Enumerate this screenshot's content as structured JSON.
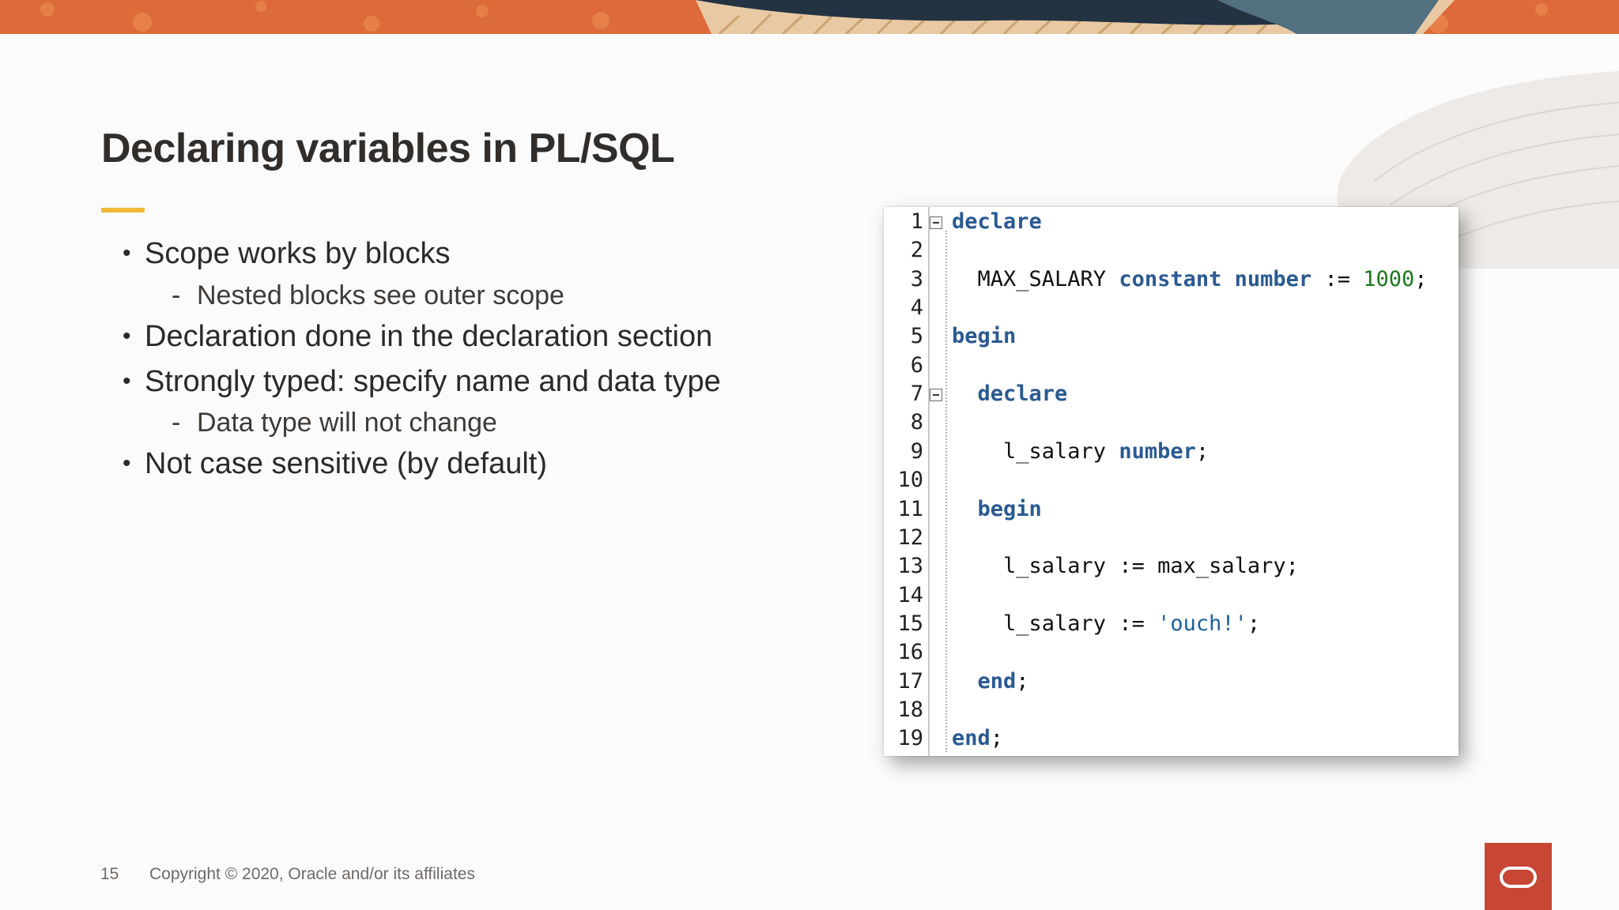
{
  "slide": {
    "title": "Declaring variables in PL/SQL",
    "bullets": [
      {
        "text": "Scope works by blocks",
        "sub": "Nested blocks see outer scope"
      },
      {
        "text": "Declaration done in the declaration section",
        "sub": ""
      },
      {
        "text": "Strongly typed: specify name and data type",
        "sub": "Data type will not change"
      },
      {
        "text": "Not case sensitive (by default)",
        "sub": ""
      }
    ],
    "bullet_glyph": "•",
    "sub_glyph": "-"
  },
  "code": {
    "line_numbers": [
      "1",
      "2",
      "3",
      "4",
      "5",
      "6",
      "7",
      "8",
      "9",
      "10",
      "11",
      "12",
      "13",
      "14",
      "15",
      "16",
      "17",
      "18",
      "19"
    ],
    "folds_at_lines": [
      1,
      7
    ],
    "lines": [
      {
        "n": 1,
        "tokens": [
          {
            "t": "declare",
            "c": "kw"
          }
        ]
      },
      {
        "n": 3,
        "tokens": [
          {
            "t": "  MAX_SALARY ",
            "c": "plain"
          },
          {
            "t": "constant",
            "c": "kw"
          },
          {
            "t": " ",
            "c": "plain"
          },
          {
            "t": "number",
            "c": "kw"
          },
          {
            "t": " := ",
            "c": "plain"
          },
          {
            "t": "1000",
            "c": "num"
          },
          {
            "t": ";",
            "c": "plain"
          }
        ]
      },
      {
        "n": 5,
        "tokens": [
          {
            "t": "begin",
            "c": "kw"
          }
        ]
      },
      {
        "n": 7,
        "tokens": [
          {
            "t": "  ",
            "c": "plain"
          },
          {
            "t": "declare",
            "c": "kw"
          }
        ]
      },
      {
        "n": 9,
        "tokens": [
          {
            "t": "    l_salary ",
            "c": "plain"
          },
          {
            "t": "number",
            "c": "kw"
          },
          {
            "t": ";",
            "c": "plain"
          }
        ]
      },
      {
        "n": 11,
        "tokens": [
          {
            "t": "  ",
            "c": "plain"
          },
          {
            "t": "begin",
            "c": "kw"
          }
        ]
      },
      {
        "n": 13,
        "tokens": [
          {
            "t": "    l_salary := max_salary;",
            "c": "plain"
          }
        ]
      },
      {
        "n": 15,
        "tokens": [
          {
            "t": "    l_salary := ",
            "c": "plain"
          },
          {
            "t": "'ouch!'",
            "c": "str"
          },
          {
            "t": ";",
            "c": "plain"
          }
        ]
      },
      {
        "n": 17,
        "tokens": [
          {
            "t": "  ",
            "c": "plain"
          },
          {
            "t": "end",
            "c": "kw"
          },
          {
            "t": ";",
            "c": "plain"
          }
        ]
      },
      {
        "n": 19,
        "tokens": [
          {
            "t": "end",
            "c": "kw"
          },
          {
            "t": ";",
            "c": "plain"
          }
        ]
      }
    ],
    "colors": {
      "keyword": "#2a5a92",
      "number": "#1b7a1b",
      "string": "#1f5fa0"
    }
  },
  "footer": {
    "page_number": "15",
    "copyright": "Copyright © 2020, Oracle and/or its affiliates",
    "logo_icon": "oracle-logo-icon"
  },
  "colors": {
    "accent_underline": "#f0b93a",
    "oracle_red": "#c74634",
    "banner": "#dc6a3a"
  }
}
